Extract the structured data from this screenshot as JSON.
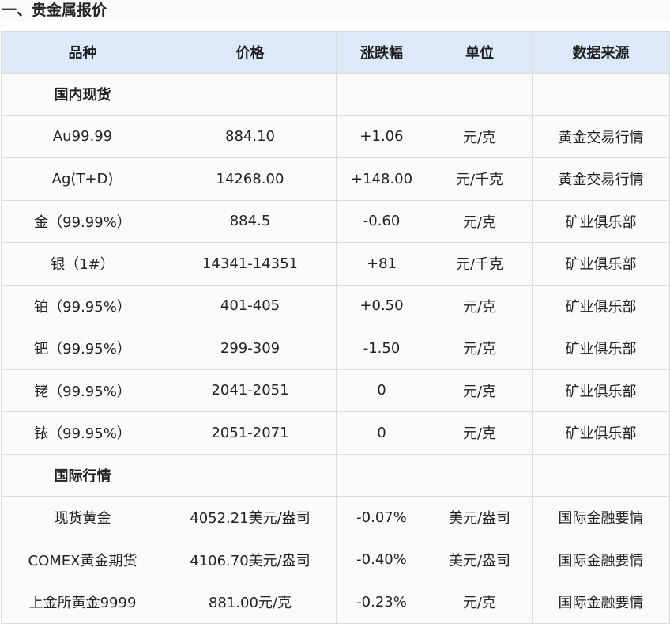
{
  "section": {
    "title": "一、贵金属报价"
  },
  "table": {
    "headers": [
      "品种",
      "价格",
      "涨跌幅",
      "单位",
      "数据来源"
    ],
    "groups": [
      {
        "name": "国内现货",
        "rows": [
          [
            "Au99.99",
            "884.10",
            "+1.06",
            "元/克",
            "黄金交易行情"
          ],
          [
            "Ag(T+D)",
            "14268.00",
            "+148.00",
            "元/千克",
            "黄金交易行情"
          ],
          [
            "金（99.99%）",
            "884.5",
            "-0.60",
            "元/克",
            "矿业俱乐部"
          ],
          [
            "银（1#）",
            "14341-14351",
            "+81",
            "元/千克",
            "矿业俱乐部"
          ],
          [
            "铂（99.95%）",
            "401-405",
            "+0.50",
            "元/克",
            "矿业俱乐部"
          ],
          [
            "钯（99.95%）",
            "299-309",
            "-1.50",
            "元/克",
            "矿业俱乐部"
          ],
          [
            "铑（99.95%）",
            "2041-2051",
            "0",
            "元/克",
            "矿业俱乐部"
          ],
          [
            "铱（99.95%）",
            "2051-2071",
            "0",
            "元/克",
            "矿业俱乐部"
          ]
        ]
      },
      {
        "name": "国际行情",
        "rows": [
          [
            "现货黄金",
            "4052.21美元/盎司",
            "-0.07%",
            "美元/盎司",
            "国际金融要情"
          ],
          [
            "COMEX黄金期货",
            "4106.70美元/盎司",
            "-0.40%",
            "美元/盎司",
            "国际金融要情"
          ],
          [
            "上金所黄金9999",
            "881.00元/克",
            "-0.23%",
            "元/克",
            "国际金融要情"
          ]
        ]
      }
    ]
  },
  "colors": {
    "header_bg": "#dbe9f9",
    "border": "#dcdcdc",
    "row_bg": "#fafafa"
  }
}
